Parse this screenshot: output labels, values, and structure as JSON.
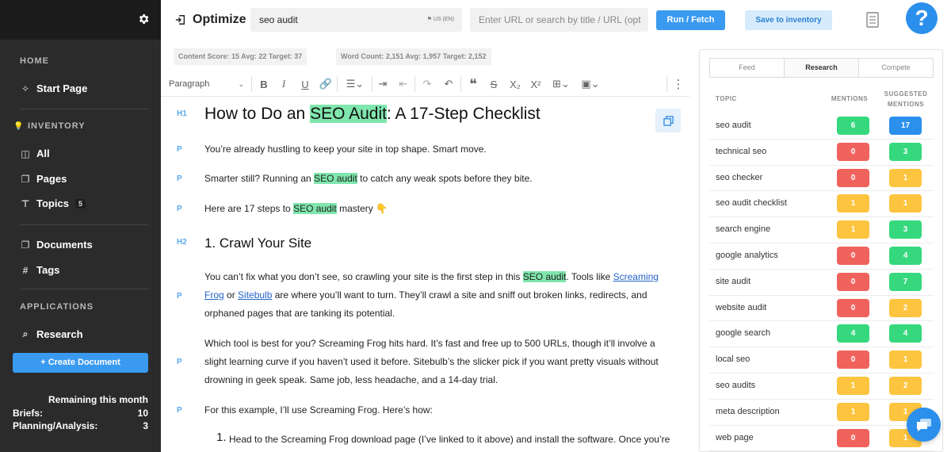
{
  "colors": {
    "accent": "#3a9af0",
    "red": "#f0625c",
    "yellow": "#fdc43f",
    "green": "#36d87e",
    "blue": "#2b8fec",
    "highlight": "#7fe6ad"
  },
  "sidebar": {
    "home_label": "HOME",
    "start_page": "Start Page",
    "inventory_label": "INVENTORY",
    "all": "All",
    "pages": "Pages",
    "topics": "Topics",
    "topics_count": "5",
    "documents": "Documents",
    "tags": "Tags",
    "applications_label": "APPLICATIONS",
    "research": "Research",
    "create_document": "+ Create Document",
    "remaining_title": "Remaining this month",
    "briefs_label": "Briefs:",
    "briefs_value": "10",
    "planning_label": "Planning/Analysis:",
    "planning_value": "3"
  },
  "topbar": {
    "title": "Optimize",
    "keyword": "seo audit",
    "locale": "US (EN)",
    "url_placeholder": "Enter URL or search by title / URL (opt",
    "run_label": "Run / Fetch",
    "save_label": "Save to inventory",
    "help_label": "?"
  },
  "stats": {
    "content_score": "Content Score: 15  Avg: 22  Target: 37",
    "word_count": "Word Count: 2,151  Avg: 1,957  Target: 2,152"
  },
  "toolbar": {
    "paragraph": "Paragraph"
  },
  "editor": {
    "tag_h1": "H1",
    "tag_h2": "H2",
    "tag_p": "P",
    "h1_pre": "How to Do an ",
    "h1_hl": "SEO Audit",
    "h1_post": ": A 17-Step Checklist",
    "p1": "You’re already hustling to keep your site in top shape. Smart move.",
    "p2_pre": "Smarter still? Running an ",
    "p2_hl": "SEO audit",
    "p2_post": " to catch any weak spots before they bite.",
    "p3_pre": "Here are 17 steps to ",
    "p3_hl": "SEO audit",
    "p3_post": " mastery 👇",
    "h2": "1. Crawl Your Site",
    "p4_a": "You can’t fix what you don’t see, so crawling your site is the first step in this ",
    "p4_hl": "SEO audit",
    "p4_b": ". Tools like ",
    "p4_link1": "Screaming Frog",
    "p4_c": " or ",
    "p4_link2": "Sitebulb",
    "p4_d": " are where you’ll want to turn. They’ll crawl a site and sniff out broken links, redirects, and orphaned pages that are tanking its potential.",
    "p5": "Which tool is best for you? Screaming Frog hits hard. It’s fast and free up to 500 URLs, though it’ll involve a slight learning curve if you haven’t used it before. Sitebulb’s the slicker pick if you want pretty visuals without drowning in geek speak. Same job, less headache, and a 14-day trial.",
    "p6": "For this example, I’ll use Screaming Frog. Here’s how:",
    "li_num": "1.",
    "li1": "Head to the Screaming Frog download page (I’ve linked to it above) and install the software. Once you’re"
  },
  "panel": {
    "tabs": [
      "Feed",
      "Research",
      "Compete"
    ],
    "col_topic": "TOPIC",
    "col_mentions": "MENTIONS",
    "col_suggested": "SUGGESTED MENTIONS",
    "rows": [
      {
        "topic": "seo audit",
        "mentions": "6",
        "m_color": "green",
        "suggested": "17",
        "s_color": "blue"
      },
      {
        "topic": "technical seo",
        "mentions": "0",
        "m_color": "red",
        "suggested": "3",
        "s_color": "green"
      },
      {
        "topic": "seo checker",
        "mentions": "0",
        "m_color": "red",
        "suggested": "1",
        "s_color": "yellow"
      },
      {
        "topic": "seo audit checklist",
        "mentions": "1",
        "m_color": "yellow",
        "suggested": "1",
        "s_color": "yellow"
      },
      {
        "topic": "search engine",
        "mentions": "1",
        "m_color": "yellow",
        "suggested": "3",
        "s_color": "green"
      },
      {
        "topic": "google analytics",
        "mentions": "0",
        "m_color": "red",
        "suggested": "4",
        "s_color": "green"
      },
      {
        "topic": "site audit",
        "mentions": "0",
        "m_color": "red",
        "suggested": "7",
        "s_color": "green"
      },
      {
        "topic": "website audit",
        "mentions": "0",
        "m_color": "red",
        "suggested": "2",
        "s_color": "yellow"
      },
      {
        "topic": "google search",
        "mentions": "4",
        "m_color": "green",
        "suggested": "4",
        "s_color": "green"
      },
      {
        "topic": "local seo",
        "mentions": "0",
        "m_color": "red",
        "suggested": "1",
        "s_color": "yellow"
      },
      {
        "topic": "seo audits",
        "mentions": "1",
        "m_color": "yellow",
        "suggested": "2",
        "s_color": "yellow"
      },
      {
        "topic": "meta description",
        "mentions": "1",
        "m_color": "yellow",
        "suggested": "1",
        "s_color": "yellow"
      },
      {
        "topic": "web page",
        "mentions": "0",
        "m_color": "red",
        "suggested": "1",
        "s_color": "yellow"
      }
    ]
  }
}
